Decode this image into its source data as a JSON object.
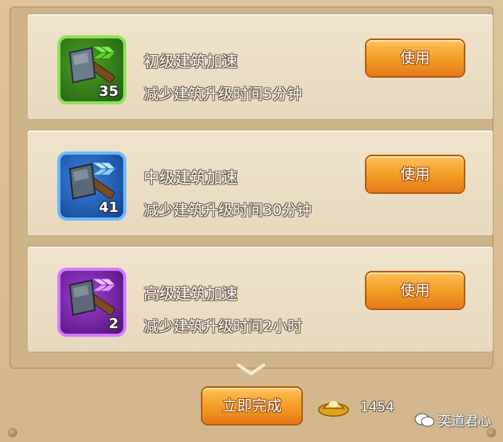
{
  "items": [
    {
      "name": "初级建筑加速",
      "desc": "减少建筑升级时间5分钟",
      "qty": "35",
      "button": "使用",
      "tier_color": "green"
    },
    {
      "name": "中级建筑加速",
      "desc": "减少建筑升级时间30分钟",
      "qty": "41",
      "button": "使用",
      "tier_color": "blue"
    },
    {
      "name": "高级建筑加速",
      "desc": "减少建筑升级时间2小时",
      "qty": "2",
      "button": "使用",
      "tier_color": "purple"
    }
  ],
  "footer": {
    "complete_label": "立即完成",
    "gold_count": "1454",
    "gold_icon": "gold-ingot-icon"
  },
  "watermark": {
    "text": "奕道君心"
  },
  "colors": {
    "accent": "#f39a22",
    "green": "#4fa127",
    "blue": "#3b84e0",
    "purple": "#a33fd6"
  }
}
